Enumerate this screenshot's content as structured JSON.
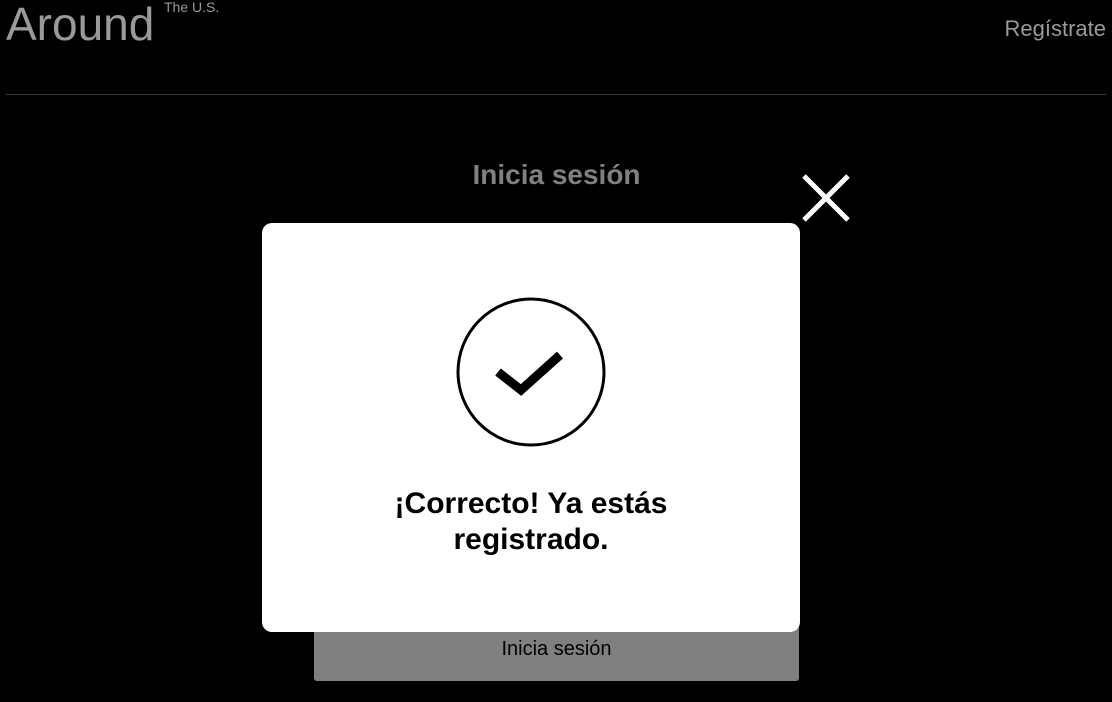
{
  "header": {
    "logo_text": "Around",
    "logo_subtext": "The U.S.",
    "signup_link": "Regístrate"
  },
  "login_form": {
    "title": "Inicia sesión",
    "submit_label": "Inicia sesión"
  },
  "modal": {
    "icon": "check-circle-icon",
    "close_icon": "close-icon",
    "message_line1": "¡Correcto! Ya estás",
    "message_line2": "registrado."
  },
  "colors": {
    "background": "#000000",
    "muted_text": "#9a9a9a",
    "dim_button": "#808080",
    "modal_bg": "#ffffff"
  }
}
